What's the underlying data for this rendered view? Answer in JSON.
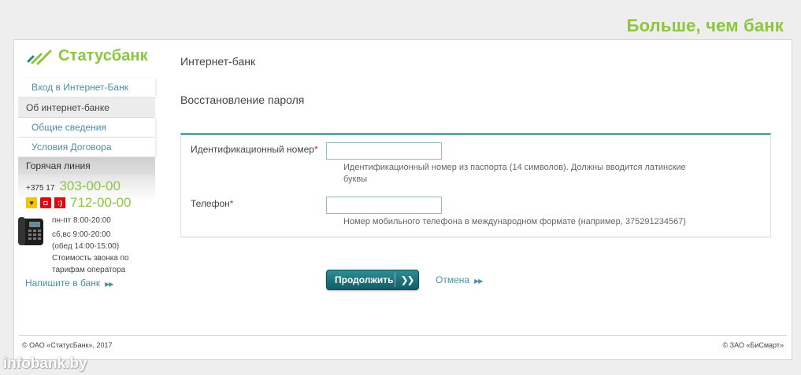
{
  "slogan": "Больше, чем банк",
  "brand": {
    "name": "Статусбанк",
    "accent": "#8cc63f",
    "link_color": "#4a8fa6"
  },
  "sidebar": {
    "items": [
      {
        "label": "Вход в Интернет-Банк",
        "type": "link"
      },
      {
        "label": "Об интернет-банке",
        "type": "group"
      },
      {
        "label": "Общие сведения",
        "type": "link"
      },
      {
        "label": "Условия Договора",
        "type": "link"
      }
    ],
    "hotline": {
      "title": "Горячая линия",
      "code": "+375 17",
      "number": "303-00-00",
      "mobile_number": "712-00-00",
      "operators": [
        "velcom-icon",
        "mts-icon",
        "life-icon"
      ],
      "hours_weekday": "пн-пт 8:00-20:00",
      "hours_weekend": "сб,вс 9:00-20:00",
      "lunch": "(обед 14:00-15:00)",
      "cost_note_1": "Стоимость звонка по",
      "cost_note_2": "тарифам оператора"
    },
    "write_link": "Напишите в банк"
  },
  "main": {
    "page_title": "Интернет-банк",
    "section_title": "Восстановление пароля",
    "form": {
      "id_label": "Идентификационный номер",
      "id_value": "",
      "id_hint_1": "Идентификационный номер из паспорта (14 символов). Должны вводится латинские",
      "id_hint_2": "буквы",
      "phone_label": "Телефон",
      "phone_value": "",
      "phone_hint": "Номер мобильного телефона в международном формате (например, 375291234567)",
      "required_mark": "*"
    },
    "continue_button": "Продолжить",
    "cancel_link": "Отмена"
  },
  "footer": {
    "left": "© ОАО «СтатусБанк», 2017",
    "right": "© ЗАО «БиСмарт»"
  },
  "watermark": "infobank.by"
}
